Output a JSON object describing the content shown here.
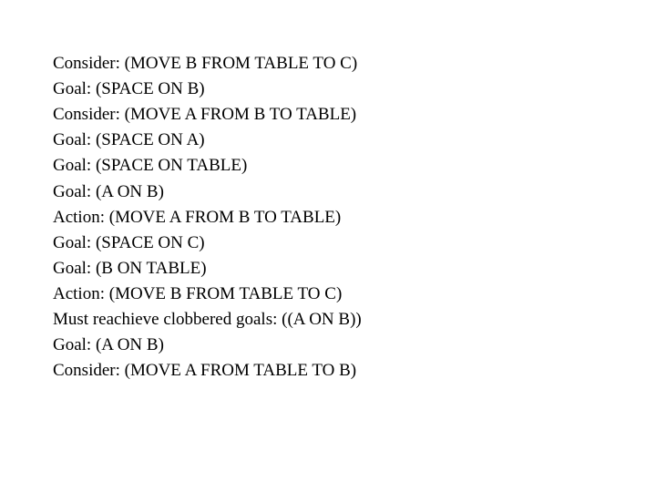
{
  "trace": {
    "lines": [
      "Consider: (MOVE B FROM TABLE TO C)",
      "Goal: (SPACE ON B)",
      "Consider: (MOVE A FROM B TO TABLE)",
      "Goal: (SPACE ON A)",
      "Goal: (SPACE ON TABLE)",
      "Goal: (A ON B)",
      "Action: (MOVE A FROM B TO TABLE)",
      "Goal: (SPACE ON C)",
      "Goal: (B ON TABLE)",
      "Action: (MOVE B FROM TABLE TO C)",
      "Must reachieve clobbered goals: ((A ON B))",
      "Goal: (A ON B)",
      "Consider: (MOVE A FROM TABLE TO B)"
    ]
  }
}
